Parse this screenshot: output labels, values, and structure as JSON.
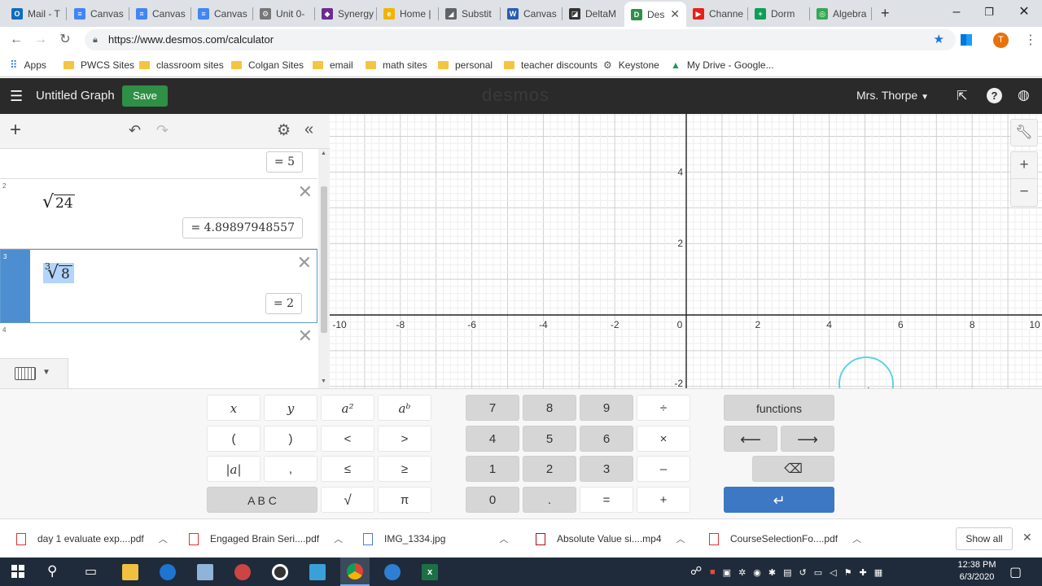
{
  "browser": {
    "tabs": [
      {
        "label": "Mail - T",
        "color": "#0f6cbd",
        "glyph": "O"
      },
      {
        "label": "Canvas",
        "color": "#4285f4",
        "glyph": "≡"
      },
      {
        "label": "Canvas",
        "color": "#4285f4",
        "glyph": "≡"
      },
      {
        "label": "Canvas",
        "color": "#4285f4",
        "glyph": "≡"
      },
      {
        "label": "Unit 0-",
        "color": "#777777",
        "glyph": "⚙"
      },
      {
        "label": "Synergy",
        "color": "#6a2c91",
        "glyph": "◆"
      },
      {
        "label": "Home |",
        "color": "#f2b400",
        "glyph": "e"
      },
      {
        "label": "Substit",
        "color": "#5f6368",
        "glyph": "◢"
      },
      {
        "label": "Canvas",
        "color": "#2a5db0",
        "glyph": "W"
      },
      {
        "label": "DeltaM",
        "color": "#333333",
        "glyph": "◪"
      },
      {
        "label": "Des",
        "color": "#2f8f46",
        "glyph": "D"
      },
      {
        "label": "Channe",
        "color": "#e62117",
        "glyph": "▶"
      },
      {
        "label": "Dorm",
        "color": "#0f9d58",
        "glyph": "+"
      },
      {
        "label": "Algebra",
        "color": "#34a853",
        "glyph": "◎"
      }
    ],
    "url": "https://www.desmos.com/calculator",
    "bookmarks": [
      "Apps",
      "PWCS Sites",
      "classroom sites",
      "Colgan Sites",
      "email",
      "math sites",
      "personal",
      "teacher discounts",
      "Keystone",
      "My Drive - Google..."
    ],
    "profile_initial": "T"
  },
  "desmos": {
    "title": "Untitled Graph",
    "save_label": "Save",
    "logo": "desmos",
    "user": "Mrs. Thorpe",
    "expressions": [
      {
        "index": "",
        "math_html": "",
        "result": "= 5"
      },
      {
        "index": "2",
        "radicand": "24",
        "root_index": "",
        "result": "= 4.89897948557"
      },
      {
        "index": "3",
        "radicand": "8",
        "root_index": "3",
        "result": "= 2"
      },
      {
        "index": "4",
        "radicand": "",
        "root_index": "",
        "result": ""
      }
    ],
    "graph": {
      "x_ticks": [
        "-10",
        "-8",
        "-6",
        "-4",
        "-2",
        "0",
        "2",
        "4",
        "6",
        "8",
        "10"
      ],
      "y_ticks": [
        "4",
        "2",
        "-2"
      ]
    }
  },
  "keypad": {
    "left": [
      "x",
      "y",
      "a²",
      "aᵇ",
      "(",
      ")",
      "<",
      ">",
      "|a|",
      ",",
      "≤",
      "≥",
      "A B C",
      "√",
      "π"
    ],
    "middle": [
      "7",
      "8",
      "9",
      "÷",
      "4",
      "5",
      "6",
      "×",
      "1",
      "2",
      "3",
      "–",
      "0",
      ".",
      "=",
      "+"
    ],
    "functions_label": "functions",
    "left_arrow": "⟵",
    "right_arrow": "⟶",
    "backspace": "⌫",
    "enter": "↵"
  },
  "downloads": {
    "items": [
      "day 1 evaluate exp....pdf",
      "Engaged Brain Seri....pdf",
      "IMG_1334.jpg",
      "Absolute Value si....mp4",
      "CourseSelectionFo....pdf"
    ],
    "show_all": "Show all"
  },
  "taskbar": {
    "time": "12:38 PM",
    "date": "6/3/2020"
  }
}
